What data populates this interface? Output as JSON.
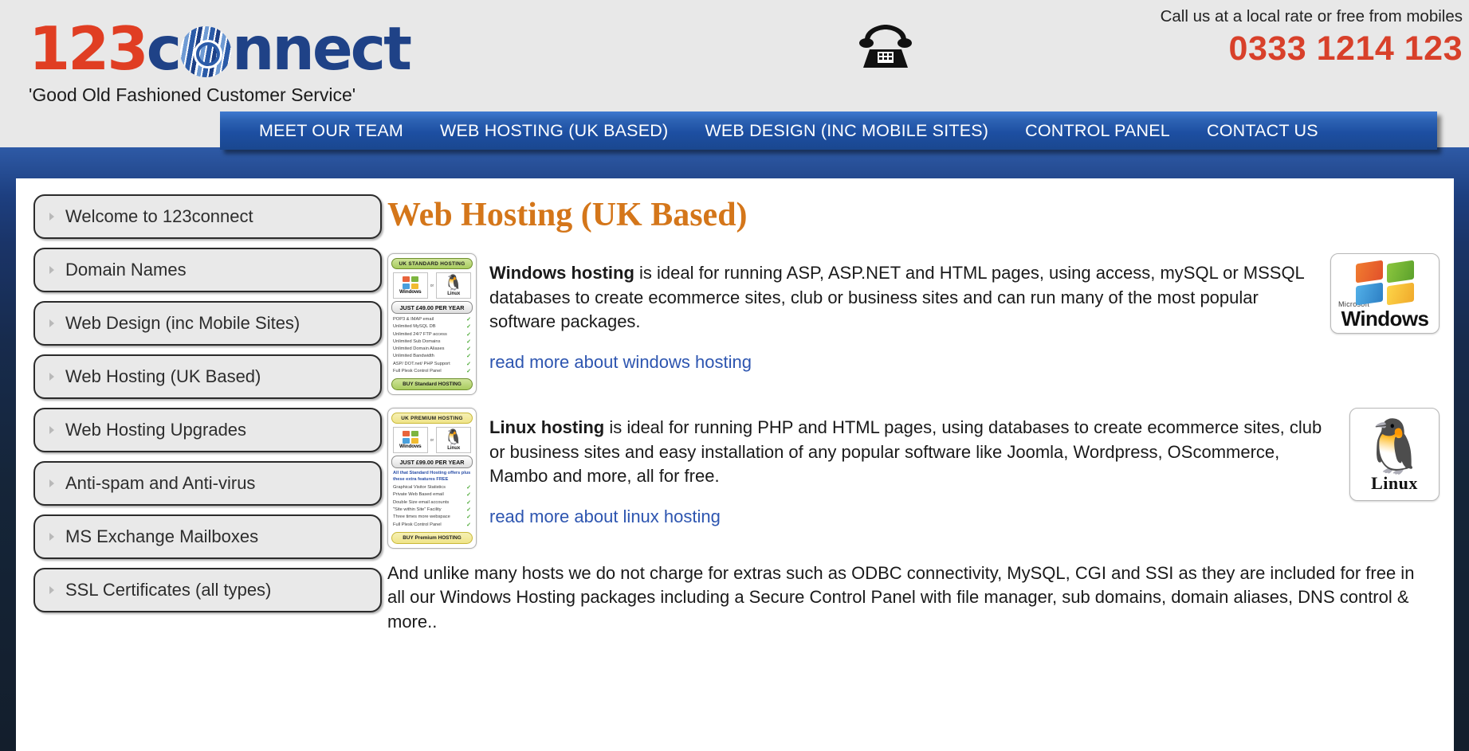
{
  "header": {
    "logo": {
      "prefix": "123",
      "suffix_before_o": "c",
      "suffix_after_o": "nnect",
      "full_text": "123connect",
      "tagline": "'Good Old Fashioned Customer Service'",
      "red_hex": "#e03e23",
      "blue_hex": "#1f4287"
    },
    "phone": {
      "tagline": "Call us at a local rate or free from mobiles",
      "number": "0333 1214 123",
      "number_hex": "#d8402a",
      "icon": "telephone-icon"
    }
  },
  "nav": {
    "items": [
      {
        "label": "MEET OUR TEAM"
      },
      {
        "label": "WEB HOSTING (UK BASED)"
      },
      {
        "label": "WEB DESIGN (INC MOBILE SITES)"
      },
      {
        "label": "CONTROL PANEL"
      },
      {
        "label": "CONTACT US"
      }
    ]
  },
  "sidebar": {
    "items": [
      {
        "label": "Welcome to 123connect"
      },
      {
        "label": "Domain Names"
      },
      {
        "label": "Web Design (inc Mobile Sites)"
      },
      {
        "label": "Web Hosting (UK Based)"
      },
      {
        "label": "Web Hosting Upgrades"
      },
      {
        "label": "Anti-spam and Anti-virus"
      },
      {
        "label": "MS Exchange Mailboxes"
      },
      {
        "label": "SSL Certificates (all types)"
      }
    ]
  },
  "main": {
    "title": "Web Hosting (UK Based)",
    "title_hex": "#d4761a",
    "sections": [
      {
        "id": "windows",
        "lead": "Windows hosting",
        "body": " is ideal for running ASP, ASP.NET and HTML pages, using access, mySQL or MSSQL databases to create ecommerce sites, club or business sites and can run many of the most popular software packages.",
        "link": "read more about windows hosting",
        "badge": {
          "micro": "Microsoft",
          "word": "Windows",
          "icon": "windows-logo-icon"
        },
        "card": {
          "banner": "UK STANDARD HOSTING",
          "os_left": "Windows",
          "os_or": "or",
          "os_right": "Linux",
          "price": "JUST £49.00 PER YEAR",
          "note": "",
          "features": [
            "POP3 & IMAP email",
            "Unlimited MySQL DB",
            "Unlimited 24/7 FTP access",
            "Unlimited Sub Domains",
            "Unlimited Domain Aliases",
            "Unlimited Bandwidth",
            "ASP/ DOT.net/ PHP Support",
            "Full Plesk Control Panel"
          ],
          "buy": "BUY Standard HOSTING"
        }
      },
      {
        "id": "linux",
        "lead": "Linux hosting",
        "body": " is ideal for running PHP and HTML pages, using databases to create ecommerce sites, club or business sites and easy installation of any popular software like Joomla, Wordpress, OScommerce, Mambo and more, all for free.",
        "link": "read more about linux hosting",
        "badge": {
          "micro": "",
          "word": "Linux",
          "icon": "linux-tux-icon"
        },
        "card": {
          "banner": "UK PREMIUM HOSTING",
          "os_left": "Windows",
          "os_or": "or",
          "os_right": "Linux",
          "price": "JUST £99.00 PER YEAR",
          "note": "All that Standard Hosting offers plus these extra features FREE",
          "features": [
            "Graphical Visitor Statistics",
            "Private Web Based email",
            "Double Size email accounts",
            "\"Site within Site\" Facility",
            "Three times more webspace",
            "Full Plesk Control Panel"
          ],
          "buy": "BUY Premium HOSTING"
        }
      }
    ],
    "closing": "And unlike many hosts we do not charge for extras such as ODBC connectivity, MySQL, CGI and SSI as they are included for free in all our Windows Hosting packages including a Secure Control Panel with file manager, sub domains, domain aliases, DNS control & more.."
  }
}
